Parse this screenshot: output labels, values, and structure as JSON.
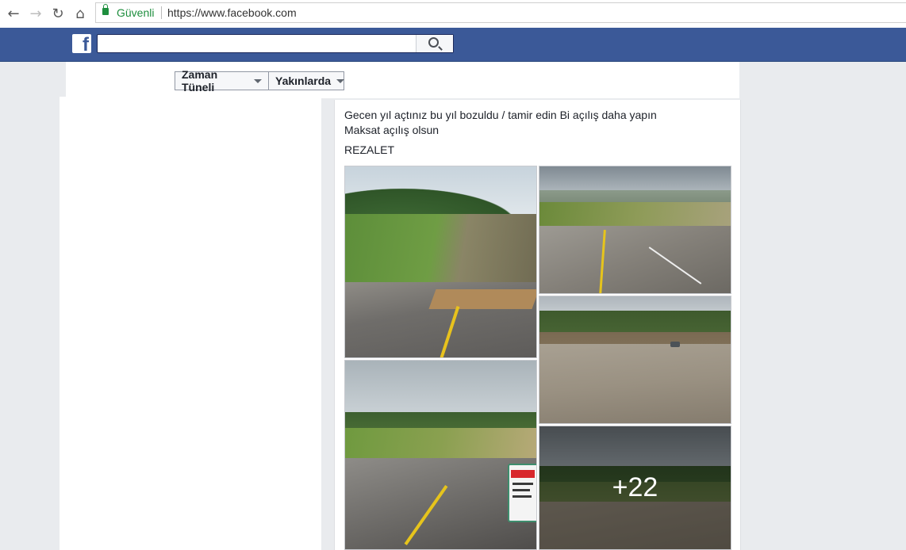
{
  "browser": {
    "secure_label": "Güvenli",
    "url": "https://www.facebook.com",
    "icons": [
      "back-arrow-icon",
      "forward-arrow-icon",
      "reload-icon",
      "home-icon",
      "lock-icon"
    ]
  },
  "header": {
    "logo_letter": "f",
    "search_placeholder": ""
  },
  "profile_nav": {
    "timeline_label": "Zaman Tüneli",
    "nearby_label": "Yakınlarda"
  },
  "post": {
    "line1": "Gecen yıl açtınız bu yıl bozuldu / tamir edin Bi açılış daha yapın",
    "line2": "Maksat açılış olsun",
    "line3": "REZALET",
    "more_photos": "+22"
  },
  "colors": {
    "fb_blue": "#3b5998",
    "page_bg": "#e9ebee",
    "secure_green": "#1e8e3e"
  }
}
